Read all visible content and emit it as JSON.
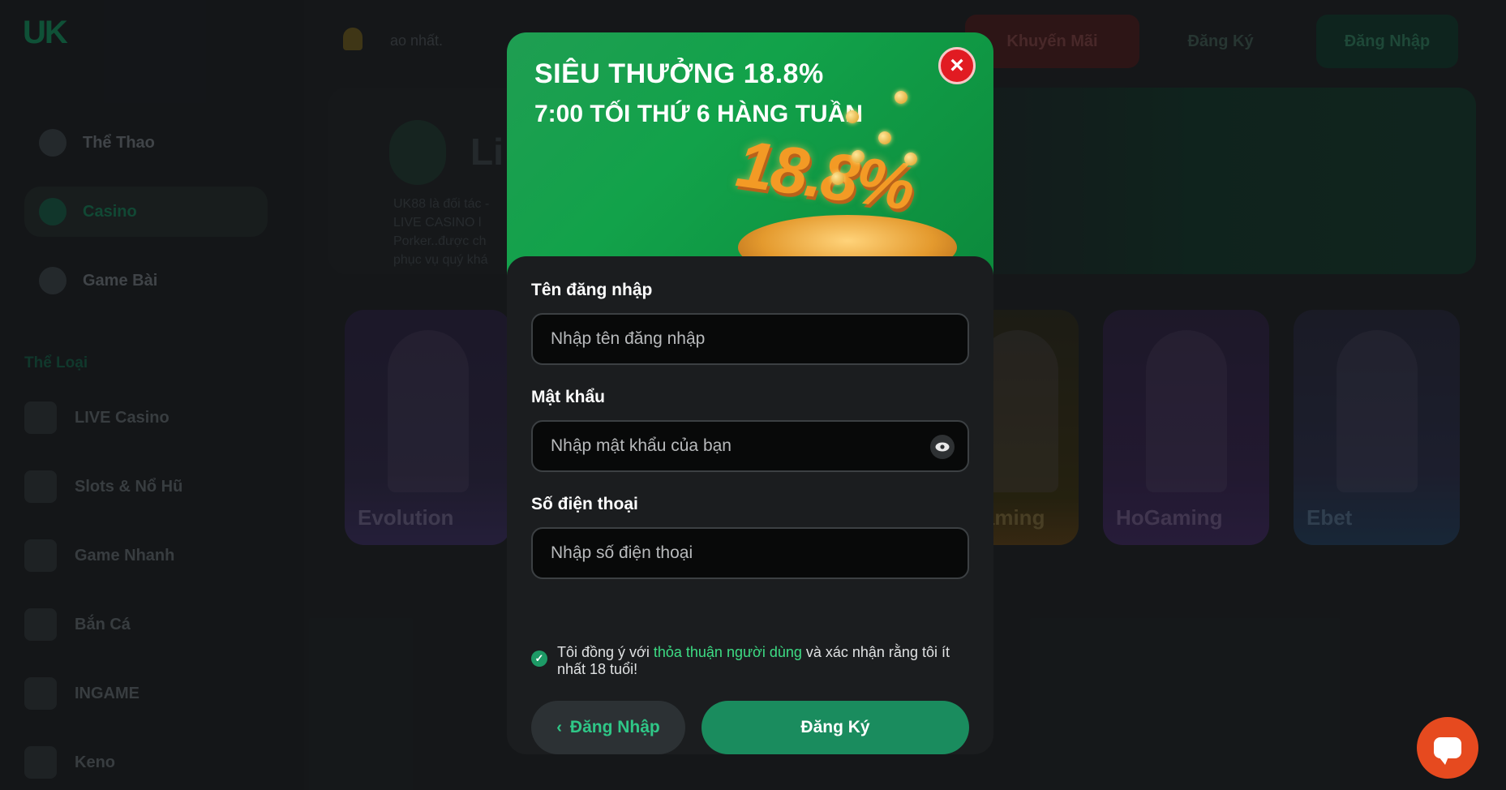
{
  "sidebar": {
    "logo": "UK",
    "items": [
      {
        "label": "Thể Thao"
      },
      {
        "label": "Casino"
      },
      {
        "label": "Game Bài"
      }
    ],
    "section_label": "Thể Loại",
    "categories": [
      {
        "label": "LIVE Casino"
      },
      {
        "label": "Slots & Nổ Hũ"
      },
      {
        "label": "Game Nhanh"
      },
      {
        "label": "Bắn Cá"
      },
      {
        "label": "INGAME"
      },
      {
        "label": "Keno"
      }
    ]
  },
  "topbar": {
    "marquee": "ao nhất.",
    "promo": "Khuyến Mãi",
    "register": "Đăng Ký",
    "login": "Đăng Nhập"
  },
  "hero": {
    "title": "Li",
    "text": "UK88 là đối tác - LIVE CASINO l Porker..được ch phục vụ quý khá"
  },
  "providers": [
    {
      "label": "Evolution"
    },
    {
      "label": "gaming"
    },
    {
      "label": "HoGaming"
    },
    {
      "label": "Ebet"
    }
  ],
  "modal": {
    "banner_title": "SIÊU THƯỞNG 18.8%",
    "banner_subtitle": "7:00 TỐI THỨ 6 HÀNG TUẦN",
    "banner_big": "18.8%",
    "close": "×",
    "username_label": "Tên đăng nhập",
    "username_placeholder": "Nhập tên đăng nhập",
    "password_label": "Mật khẩu",
    "password_placeholder": "Nhập mật khẩu của bạn",
    "phone_label": "Số điện thoại",
    "phone_placeholder": "Nhập số điện thoại",
    "agree_prefix": "Tôi đồng ý với ",
    "agree_link": "thỏa thuận người dùng",
    "agree_suffix": " và xác nhận rằng tôi ít nhất 18 tuổi!",
    "back_button": "Đăng Nhập",
    "submit_button": "Đăng Ký"
  },
  "colors": {
    "accent": "#1a8c5e",
    "link": "#3ddc84",
    "close": "#e11b22",
    "chat": "#e64a1f"
  }
}
